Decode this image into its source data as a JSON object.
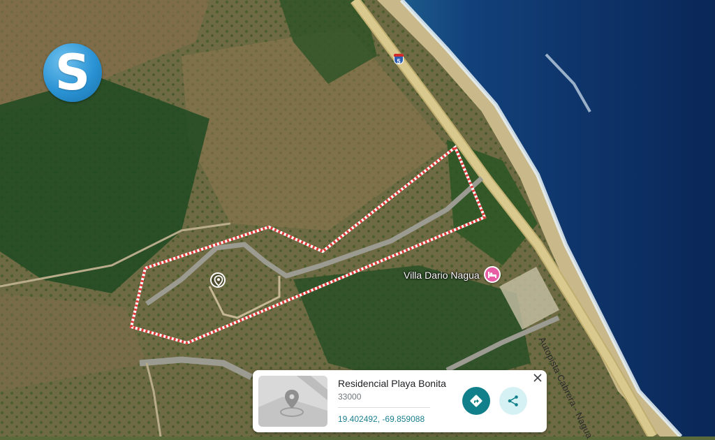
{
  "map": {
    "place_label": "Villa Dario Nagua",
    "road_label": "Autopista Cabrera - Nagua",
    "highway_shield": "5",
    "colors": {
      "ocean_deep": "#0c2a5e",
      "ocean_shallow": "#1f5f8f",
      "road": "#cdbb80",
      "boundary": "#e23b3b",
      "hotel_pin": "#e85ea5"
    }
  },
  "logo": {
    "letter": "S",
    "icon": "brand-logo-icon"
  },
  "card": {
    "name": "Residencial Playa Bonita",
    "postal_code": "33000",
    "coordinates": "19.402492, -69.859088",
    "icons": {
      "directions": "directions-icon",
      "share": "share-icon",
      "close": "close-icon",
      "thumbnail": "location-thumbnail-icon"
    },
    "colors": {
      "directions_bg": "#11808a",
      "share_bg": "#d5f1f4",
      "coords_text": "#1a7f8e"
    }
  }
}
